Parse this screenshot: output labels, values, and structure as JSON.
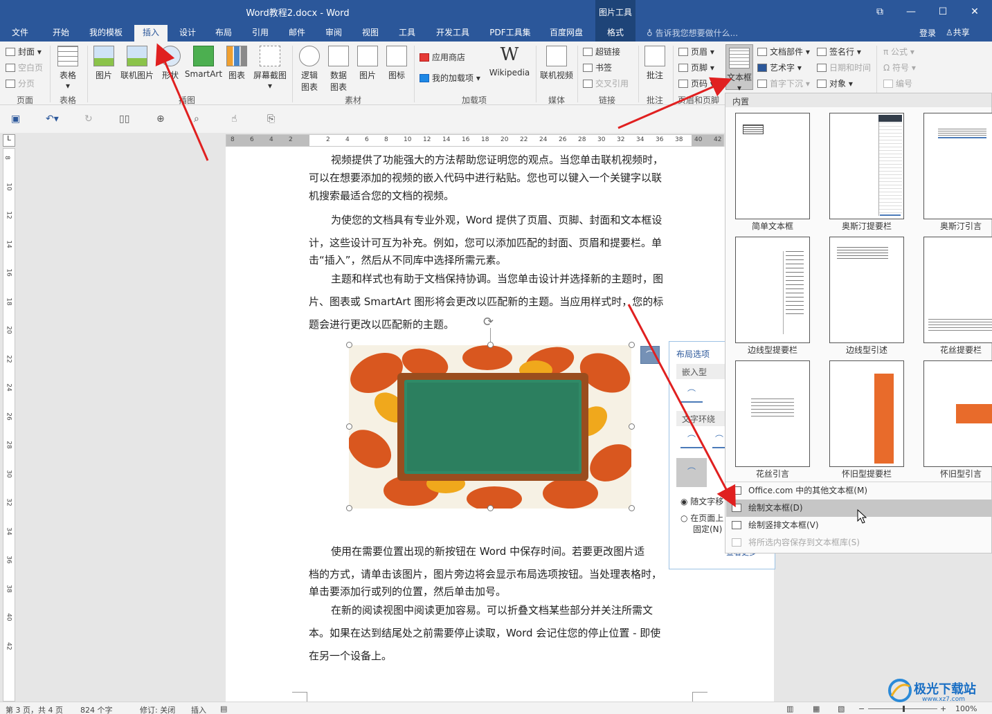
{
  "window": {
    "title": "Word教程2.docx - Word",
    "context_group": "图片工具",
    "buttons": {
      "restore": "⧉",
      "minimize": "—",
      "maximize": "☐",
      "close": "✕"
    }
  },
  "tabs": [
    {
      "label": "文件"
    },
    {
      "label": "开始"
    },
    {
      "label": "我的模板"
    },
    {
      "label": "插入"
    },
    {
      "label": "设计"
    },
    {
      "label": "布局"
    },
    {
      "label": "引用"
    },
    {
      "label": "邮件"
    },
    {
      "label": "审阅"
    },
    {
      "label": "视图"
    },
    {
      "label": "工具"
    },
    {
      "label": "开发工具"
    },
    {
      "label": "PDF工具集"
    },
    {
      "label": "百度网盘"
    },
    {
      "label": "格式"
    }
  ],
  "tellme": "告诉我您想要做什么...",
  "account": {
    "login": "登录",
    "share": "共享"
  },
  "ribbon": {
    "pages": {
      "cover": "封面",
      "blank": "空白页",
      "break": "分页",
      "group": "页面"
    },
    "tables": {
      "table": "表格",
      "group": "表格"
    },
    "illustrations": {
      "picture": "图片",
      "online_picture": "联机图片",
      "shapes": "形状",
      "smartart": "SmartArt",
      "chart": "图表",
      "screenshot": "屏幕截图",
      "group": "插图"
    },
    "materials": {
      "logic_chart": "逻辑\n图表",
      "data_chart": "数据\n图表",
      "picture": "图片",
      "icon": "图标",
      "group": "素材"
    },
    "addins": {
      "store": "应用商店",
      "my_addins": "我的加载项",
      "wikipedia": "Wikipedia",
      "group": "加载项"
    },
    "media": {
      "online_video": "联机视频",
      "group": "媒体"
    },
    "links": {
      "hyperlink": "超链接",
      "bookmark": "书签",
      "cross_ref": "交叉引用",
      "group": "链接"
    },
    "comments": {
      "comment": "批注",
      "group": "批注"
    },
    "header_footer": {
      "header": "页眉",
      "footer": "页脚",
      "page_number": "页码",
      "group": "页眉和页脚"
    },
    "text": {
      "textbox": "文本框",
      "quick_parts": "文档部件",
      "wordart": "艺术字",
      "dropcap": "首字下沉",
      "signature": "签名行",
      "datetime": "日期和时间",
      "object": "对象"
    },
    "symbols": {
      "equation": "公式",
      "symbol": "符号",
      "number": "编号"
    }
  },
  "ruler": {
    "h_left": [
      "8",
      "6",
      "4",
      "2"
    ],
    "h_right": [
      "2",
      "4",
      "6",
      "8",
      "10",
      "12",
      "14",
      "16",
      "18",
      "20",
      "22",
      "24",
      "26",
      "28",
      "30",
      "32",
      "34",
      "36",
      "38",
      "40",
      "42"
    ],
    "v": [
      "8",
      "10",
      "12",
      "14",
      "16",
      "18",
      "20",
      "22",
      "24",
      "26",
      "28",
      "30",
      "32",
      "34",
      "36",
      "38",
      "40",
      "42"
    ]
  },
  "document": {
    "paragraphs": [
      "视频提供了功能强大的方法帮助您证明您的观点。当您单击联机视频时，可以在想要添加的视频的嵌入代码中进行粘贴。您也可以键入一个关键字以联机搜索最适合您的文档的视频。",
      "为使您的文档具有专业外观，Word 提供了页眉、页脚、封面和文本框设计，这些设计可互为补充。例如，您可以添加匹配的封面、页眉和提要栏。单击“插入”，然后从不同库中选择所需元素。",
      "主题和样式也有助于文档保持协调。当您单击设计并选择新的主题时，图片、图表或 SmartArt 图形将会更改以匹配新的主题。当应用样式时，您的标题会进行更改以匹配新的主题。",
      "使用在需要位置出现的新按钮在 Word 中保存时间。若要更改图片适应文档的方式，请单击该图片，图片旁边将会显示布局选项按钮。当处理表格时，单击要添加行或列的位置，然后单击加号。",
      "在新的阅读视图中阅读更加容易。可以折叠文档某些部分并关注所需文本。如果在达到结尾处之前需要停止读取，Word 会记住您的停止位置 - 即使在另一个设备上。"
    ],
    "lines": [
      [
        "视频提供了功能强大的方法帮助您证明您的观点。当您单击联机视频时，",
        "可以在想要添加的视频的嵌入代码中进行粘贴。您也可以键入一个关键字以联",
        "机搜索最适合您的文档的视频。"
      ],
      [
        "为使您的文档具有专业外观，Word 提供了页眉、页脚、封面和文本框设",
        "计，这些设计可互为补充。例如，您可以添加匹配的封面、页眉和提要栏。单",
        "击“插入”，然后从不同库中选择所需元素。"
      ],
      [
        "主题和样式也有助于文档保持协调。当您单击设计并选择新的主题时，图",
        "片、图表或 SmartArt 图形将会更改以匹配新的主题。当应用样式时，您的标",
        "题会进行更改以匹配新的主题。"
      ],
      [
        "使用在需要位置出现的新按钮在 Word 中保存时间。若要更改图片适",
        "档的方式，请单击该图片，图片旁边将会显示布局选项按钮。当处理表格时，",
        "单击要添加行或列的位置，然后单击加号。"
      ],
      [
        "在新的阅读视图中阅读更加容易。可以折叠文档某些部分并关注所需文",
        "本。如果在达到结尾处之前需要停止读取，Word 会记住您的停止位置 - 即使",
        "在另一个设备上。"
      ]
    ]
  },
  "layout_options": {
    "title": "布局选项",
    "inline_header": "嵌入型",
    "wrap_header": "文字环绕",
    "move_with_text": "随文字移",
    "fix_on_page": "在页面上",
    "fix_on_page_2": "固定(N)",
    "see_more": "查看更多"
  },
  "textbox_menu": {
    "section": "内置",
    "tiles": [
      {
        "label": "简单文本框"
      },
      {
        "label": "奥斯汀提要栏"
      },
      {
        "label": "奥斯汀引言"
      },
      {
        "label": "边线型提要栏"
      },
      {
        "label": "边线型引述"
      },
      {
        "label": "花丝提要栏"
      },
      {
        "label": "花丝引言"
      },
      {
        "label": "怀旧型提要栏"
      },
      {
        "label": "怀旧型引言"
      }
    ],
    "items": [
      {
        "label": "Office.com 中的其他文本框(M)"
      },
      {
        "label": "绘制文本框(D)"
      },
      {
        "label": "绘制竖排文本框(V)"
      },
      {
        "label": "将所选内容保存到文本框库(S)"
      }
    ]
  },
  "status": {
    "page": "第 3 页，共 4 页",
    "words": "824 个字",
    "track": "修订: 关闭",
    "mode": "插入",
    "zoom": "100%"
  },
  "watermark": {
    "text": "极光下载站",
    "url": "www.xz7.com"
  },
  "colors": {
    "brand": "#2b579a",
    "context": "#1e4478",
    "arrow": "#e02020",
    "accent_orange": "#e86b2b"
  }
}
